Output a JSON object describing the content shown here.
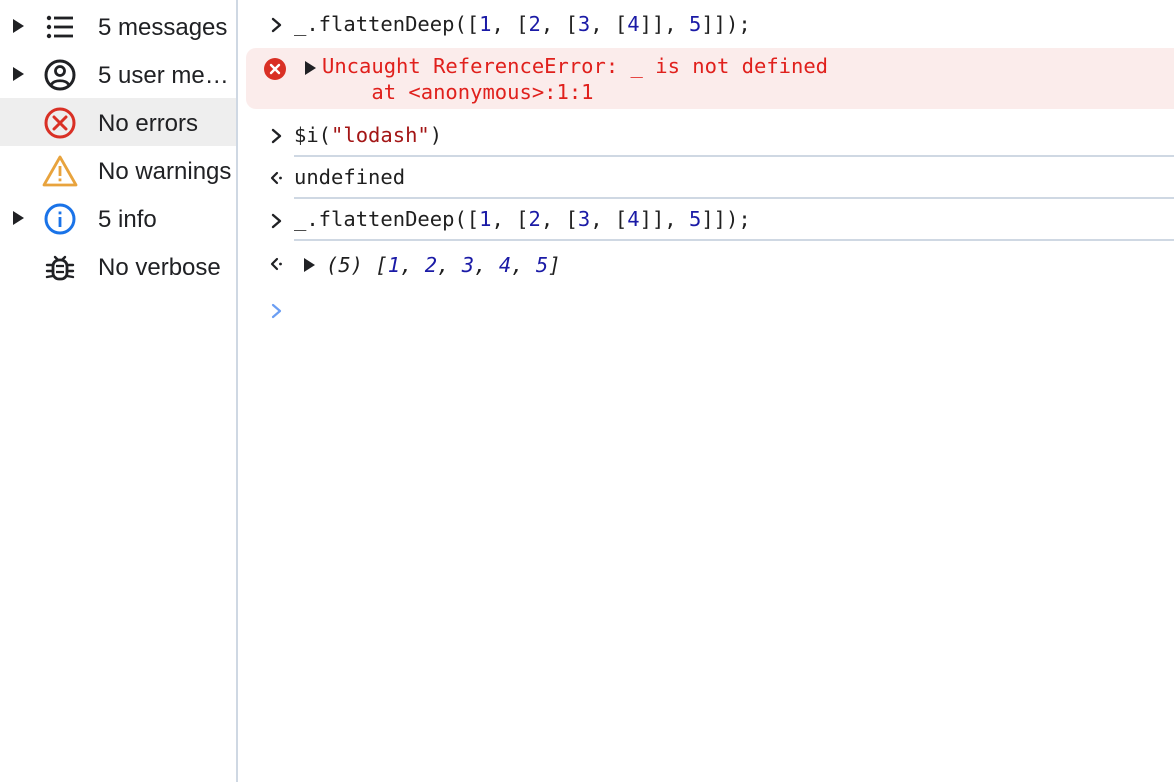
{
  "sidebar": {
    "items": [
      {
        "label": "5 messages",
        "icon": "list-icon",
        "expandable": true
      },
      {
        "label": "5 user me…",
        "icon": "user-icon",
        "expandable": true
      },
      {
        "label": "No errors",
        "icon": "error-icon",
        "expandable": false,
        "selected": true
      },
      {
        "label": "No warnings",
        "icon": "warning-icon",
        "expandable": false
      },
      {
        "label": "5 info",
        "icon": "info-icon",
        "expandable": true
      },
      {
        "label": "No verbose",
        "icon": "bug-icon",
        "expandable": false
      }
    ]
  },
  "console": {
    "entries": [
      {
        "kind": "input",
        "parts": [
          "_.flattenDeep([",
          "1",
          ", [",
          "2",
          ", [",
          "3",
          ", [",
          "4",
          "]], ",
          "5",
          "]]);"
        ]
      },
      {
        "kind": "error",
        "line1": "Uncaught ReferenceError: _ is not defined",
        "line2": "    at <anonymous>:1:1"
      },
      {
        "kind": "input",
        "parts": [
          "$i(",
          "\"lodash\"",
          ")"
        ]
      },
      {
        "kind": "output",
        "text": "undefined"
      },
      {
        "kind": "input",
        "parts": [
          "_.flattenDeep([",
          "1",
          ", [",
          "2",
          ", [",
          "3",
          ", [",
          "4",
          "]], ",
          "5",
          "]]);"
        ]
      },
      {
        "kind": "output",
        "parts": [
          "(5) [",
          "1",
          ", ",
          "2",
          ", ",
          "3",
          ", ",
          "4",
          ", ",
          "5",
          "]"
        ]
      }
    ]
  },
  "colors": {
    "number": "#1a1aa6",
    "string": "#a31515",
    "error_text": "#e0201c",
    "error_bg": "#fbeceb",
    "prompt_active": "#6b9ef3",
    "separator": "#cfd8e3"
  }
}
